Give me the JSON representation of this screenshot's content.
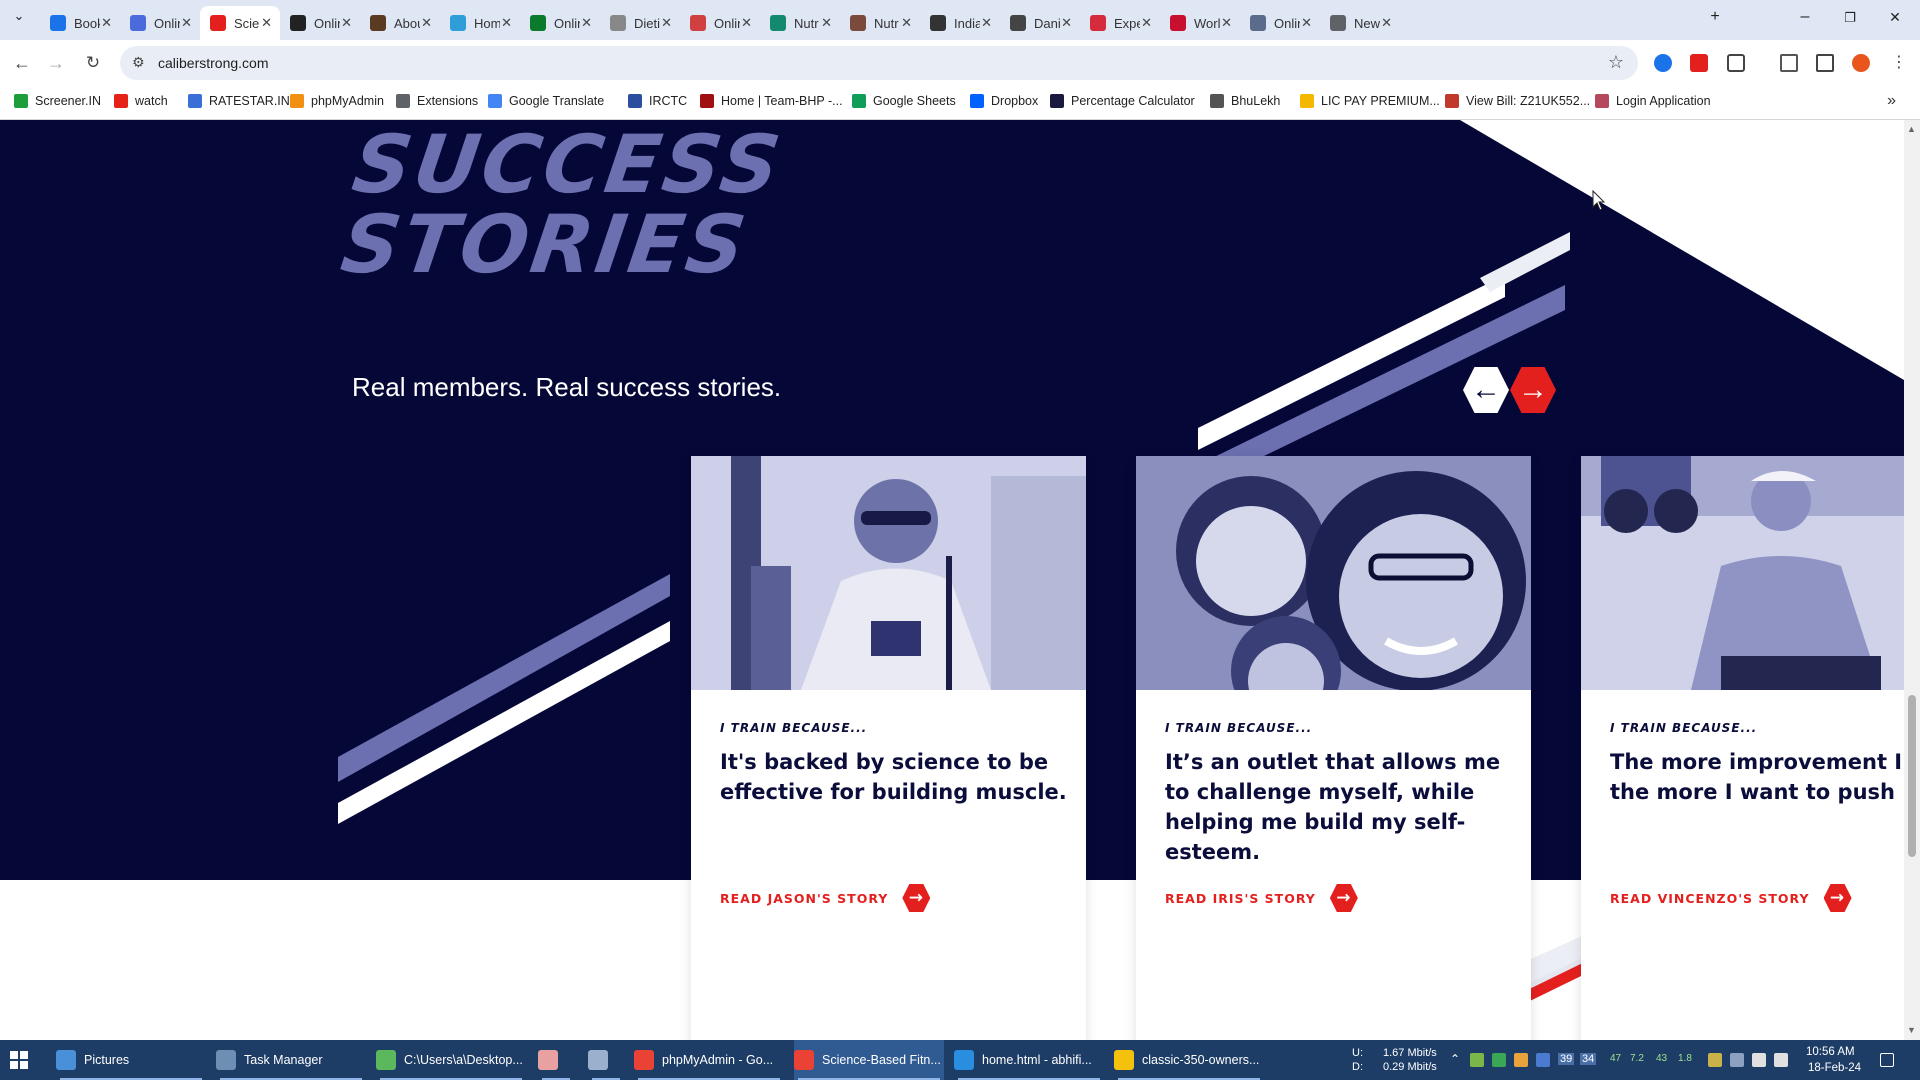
{
  "browser": {
    "tabs": [
      {
        "title": "Book",
        "favicon_color": "#1a73e8"
      },
      {
        "title": "Onlin",
        "favicon_color": "#4b6bdc"
      },
      {
        "title": "Scien",
        "favicon_color": "#e4201f",
        "active": true
      },
      {
        "title": "Onlin",
        "favicon_color": "#222222"
      },
      {
        "title": "Abou",
        "favicon_color": "#5a3a20"
      },
      {
        "title": "Hom",
        "favicon_color": "#2f9ed8"
      },
      {
        "title": "Onlin",
        "favicon_color": "#0b7a2a"
      },
      {
        "title": "Dieti",
        "favicon_color": "#888888"
      },
      {
        "title": "Onlin",
        "favicon_color": "#d04040"
      },
      {
        "title": "Nutr",
        "favicon_color": "#138a6e"
      },
      {
        "title": "Nutr",
        "favicon_color": "#7a4a3a"
      },
      {
        "title": "India",
        "favicon_color": "#333333"
      },
      {
        "title": "Dani",
        "favicon_color": "#444444"
      },
      {
        "title": "Expe",
        "favicon_color": "#d62a3d"
      },
      {
        "title": "Worl",
        "favicon_color": "#c8102e"
      },
      {
        "title": "Onlin",
        "favicon_color": "#5a6b8c"
      },
      {
        "title": "New",
        "favicon_color": "#5f6368"
      }
    ],
    "new_tab_label": "+",
    "window_controls": {
      "minimize": "–",
      "restore": "❐",
      "close": "✕"
    },
    "url": "caliberstrong.com",
    "bookmarks": [
      {
        "label": "Screener.IN",
        "icon_color": "#1e9e3a"
      },
      {
        "label": "watch",
        "icon_color": "#e62117"
      },
      {
        "label": "RATESTAR.IN",
        "icon_color": "#3a6fd8"
      },
      {
        "label": "phpMyAdmin",
        "icon_color": "#f29111"
      },
      {
        "label": "Extensions",
        "icon_color": "#5f6368"
      },
      {
        "label": "Google Translate",
        "icon_color": "#4285f4"
      },
      {
        "label": "IRCTC",
        "icon_color": "#2b4f9e"
      },
      {
        "label": "Home | Team-BHP -...",
        "icon_color": "#a01010"
      },
      {
        "label": "Google Sheets",
        "icon_color": "#0f9d58"
      },
      {
        "label": "Dropbox",
        "icon_color": "#0061fe"
      },
      {
        "label": "Percentage Calculator",
        "icon_color": "#1a1a40"
      },
      {
        "label": "BhuLekh",
        "icon_color": "#555555"
      },
      {
        "label": "LIC PAY PREMIUM...",
        "icon_color": "#f5b800"
      },
      {
        "label": "View Bill: Z21UK552...",
        "icon_color": "#c0392b"
      },
      {
        "label": "Login Application",
        "icon_color": "#b5485d"
      }
    ],
    "bookmarks_more": "»"
  },
  "page": {
    "heading_line1": "SUCCESS",
    "heading_line2": "STORIES",
    "subtitle": "Real members. Real success stories.",
    "prev_label": "←",
    "next_label": "→",
    "colors": {
      "navy": "#050737",
      "periwinkle": "#6c6fb0",
      "red": "#e4201f",
      "white": "#ffffff"
    },
    "cards": [
      {
        "eyebrow": "I TRAIN BECAUSE...",
        "quote": "It's backed by science to be effective for building muscle.",
        "cta": "READ JASON'S STORY"
      },
      {
        "eyebrow": "I TRAIN BECAUSE...",
        "quote": "It’s an outlet that allows me to challenge myself, while helping me build my self-esteem.",
        "cta": "READ IRIS'S STORY"
      },
      {
        "eyebrow": "I TRAIN BECAUSE...",
        "quote": "The more improvement I see, the more I want to push myself.",
        "cta": "READ VINCENZO'S STORY"
      }
    ]
  },
  "taskbar": {
    "items": [
      {
        "label": "Pictures",
        "icon_color": "#4a90d9"
      },
      {
        "label": "Task Manager",
        "icon_color": "#6d8fb3"
      },
      {
        "label": "C:\\Users\\a\\Desktop...",
        "icon_color": "#5cb85c"
      },
      {
        "label": "",
        "icon_color": "#e8a0a0"
      },
      {
        "label": "",
        "icon_color": "#9ab0cc"
      },
      {
        "label": "phpMyAdmin - Go...",
        "icon_color": "#ea4335"
      },
      {
        "label": "Science-Based Fitn...",
        "icon_color": "#ea4335",
        "active": true
      },
      {
        "label": "home.html - abhifi...",
        "icon_color": "#2a8ee0"
      },
      {
        "label": "classic-350-owners...",
        "icon_color": "#f4c20d"
      }
    ],
    "net_up_label": "U:",
    "net_down_label": "D:",
    "net_up": "1.67 Mbit/s",
    "net_down": "0.29 Mbit/s",
    "tray_numbers": [
      "39",
      "34",
      "47",
      "7.2",
      "43",
      "1.8"
    ],
    "time": "10:56 AM",
    "date": "18-Feb-24"
  }
}
